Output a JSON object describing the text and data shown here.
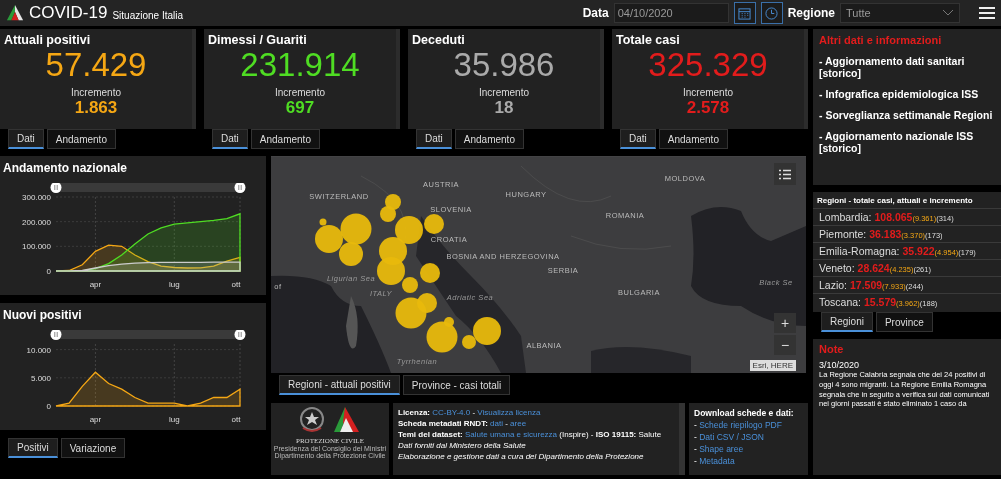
{
  "header": {
    "title": "COVID-19",
    "subtitle": "Situazione Italia",
    "date_label": "Data",
    "date_value": "04/10/2020",
    "region_label": "Regione",
    "region_value": "Tutte"
  },
  "kpis": [
    {
      "title": "Attuali positivi",
      "value": "57.429",
      "inc_label": "Incremento",
      "inc_value": "1.863",
      "color": "#f5a714",
      "tabs": [
        {
          "label": "Dati",
          "selected": true
        },
        {
          "label": "Andamento",
          "selected": false
        }
      ]
    },
    {
      "title": "Dimessi / Guariti",
      "value": "231.914",
      "inc_label": "Incremento",
      "inc_value": "697",
      "color": "#4fdd23",
      "tabs": [
        {
          "label": "Dati",
          "selected": true
        },
        {
          "label": "Andamento",
          "selected": false
        }
      ]
    },
    {
      "title": "Deceduti",
      "value": "35.986",
      "inc_label": "Incremento",
      "inc_value": "18",
      "color": "#aaaaaa",
      "tabs": [
        {
          "label": "Dati",
          "selected": true
        },
        {
          "label": "Andamento",
          "selected": false
        }
      ]
    },
    {
      "title": "Totale casi",
      "value": "325.329",
      "inc_label": "Incremento",
      "inc_value": "2.578",
      "color": "#e21c1c",
      "tabs": [
        {
          "label": "Dati",
          "selected": true
        },
        {
          "label": "Andamento",
          "selected": false
        }
      ]
    }
  ],
  "charts": [
    {
      "title": "Andamento nazionale",
      "chart_data": {
        "type": "area",
        "grid": true,
        "categories": [
          null,
          null,
          null,
          "apr",
          null,
          null,
          null,
          null,
          null,
          "lug",
          null,
          null,
          null,
          null,
          "ott"
        ],
        "ylim": [
          0,
          300
        ],
        "yticks": [
          {
            "value": 0,
            "label": "0"
          },
          {
            "value": 100,
            "label": "100.000"
          },
          {
            "value": 200,
            "label": "200.000"
          },
          {
            "value": 300,
            "label": "300.000"
          }
        ],
        "series": [
          {
            "color": "#f5a714",
            "values": [
              0,
              2,
              25,
              80,
              105,
              100,
              65,
              38,
              20,
              14,
              12,
              13,
              20,
              40,
              55
            ]
          },
          {
            "color": "#4fdd23",
            "values": [
              0,
              0,
              1,
              10,
              30,
              65,
              110,
              150,
              175,
              190,
              195,
              200,
              205,
              212,
              232
            ]
          },
          {
            "color": "#cccccc",
            "values": [
              0,
              0,
              2,
              12,
              22,
              28,
              32,
              34,
              35,
              35,
              35,
              35,
              36,
              36,
              36
            ]
          }
        ]
      }
    },
    {
      "title": "Nuovi positivi",
      "chart_data": {
        "type": "area",
        "grid": true,
        "categories": [
          null,
          null,
          null,
          "apr",
          null,
          null,
          null,
          null,
          null,
          "lug",
          null,
          null,
          null,
          null,
          "ott"
        ],
        "ylim": [
          0,
          11
        ],
        "yticks": [
          {
            "value": 0,
            "label": "0"
          },
          {
            "value": 5,
            "label": "5.000"
          },
          {
            "value": 10,
            "label": "10.000"
          }
        ],
        "series": [
          {
            "color": "#f5a714",
            "values": [
              0,
              0.5,
              3.5,
              6,
              4,
              3,
              1.5,
              0.5,
              0.5,
              0.5,
              0,
              0.5,
              1.5,
              1.5,
              3
            ]
          }
        ]
      }
    }
  ],
  "chart_tabs": [
    {
      "label": "Positivi",
      "selected": true
    },
    {
      "label": "Variazione",
      "selected": false
    }
  ],
  "map": {
    "labels": [
      "SWITZERLAND",
      "AUSTRIA",
      "HUNGARY",
      "MOLDOVA",
      "SLOVENIA",
      "ROMANIA",
      "CROATIA",
      "BOSNIA AND HERZEGOVINA",
      "SERBIA",
      "BULGARIA",
      "ALBANIA",
      "Ligurian Sea",
      "ITALY",
      "Adriatic Sea",
      "Tyrrhenian",
      "Black Se",
      "of"
    ],
    "zoom_in": "+",
    "zoom_out": "−",
    "attribution": "Esri, HERE"
  },
  "map_tabs": [
    {
      "label": "Regioni - attuali positivi",
      "selected": true
    },
    {
      "label": "Province - casi totali",
      "selected": false
    }
  ],
  "logo": {
    "name": "PROTEZIONE CIVILE",
    "line_1": "Presidenza del Consiglio dei Ministri",
    "line_2": "Dipartimento della Protezione Civile"
  },
  "info_lines": [
    [
      {
        "kind": "label",
        "text": "Licenza:"
      },
      {
        "kind": "link",
        "text": "CC-BY-4.0"
      },
      {
        "kind": "text",
        "text": "-"
      },
      {
        "kind": "link",
        "text": "Visualizza licenza"
      }
    ],
    [
      {
        "kind": "label",
        "text": "Scheda metadati RNDT:"
      },
      {
        "kind": "link",
        "text": "dati"
      },
      {
        "kind": "text",
        "text": "-"
      },
      {
        "kind": "link",
        "text": "aree"
      }
    ],
    [
      {
        "kind": "label",
        "text": "Temi del dataset:"
      },
      {
        "kind": "link",
        "text": "Salute umana e sicurezza"
      },
      {
        "kind": "text",
        "text": "(Inspire) -"
      },
      {
        "kind": "label",
        "text": "ISO 19115:"
      },
      {
        "kind": "text",
        "text": "Salute"
      }
    ],
    [
      {
        "kind": "italic",
        "text": "Dati forniti dal Ministero della Salute"
      }
    ],
    [
      {
        "kind": "italic",
        "text": "Elaborazione e gestione dati a cura del Dipartimento della Protezione"
      }
    ]
  ],
  "downloads": {
    "title": "Download schede e dati:",
    "items": [
      {
        "bullet": "-",
        "link": "Schede riepilogo PDF"
      },
      {
        "bullet": "-",
        "link": "Dati CSV / JSON"
      },
      {
        "bullet": "-",
        "link": "Shape aree"
      },
      {
        "bullet": "-",
        "link": "Metadata"
      }
    ]
  },
  "other_info": {
    "title": "Altri dati e informazioni",
    "links": [
      "- Aggiornamento dati sanitari [storico]",
      "- Infografica epidemiologica ISS",
      "- Sorveglianza settimanale Regioni",
      "- Aggiornamento nazionale ISS [storico]"
    ]
  },
  "regions": {
    "title": "Regioni - totale casi, attuali e incremento",
    "rows": [
      {
        "name": "Lombardia:",
        "total": "108.065",
        "current": "(9.361)",
        "increase": "(314)"
      },
      {
        "name": "Piemonte:",
        "total": "36.183",
        "current": "(3.370)",
        "increase": "(173)"
      },
      {
        "name": "Emilia-Romagna:",
        "total": "35.922",
        "current": "(4.954)",
        "increase": "(179)"
      },
      {
        "name": "Veneto:",
        "total": "28.624",
        "current": "(4.235)",
        "increase": "(261)"
      },
      {
        "name": "Lazio:",
        "total": "17.509",
        "current": "(7.933)",
        "increase": "(244)"
      },
      {
        "name": "Toscana:",
        "total": "15.579",
        "current": "(3.962)",
        "increase": "(188)"
      }
    ]
  },
  "region_tabs": [
    {
      "label": "Regioni",
      "selected": true
    },
    {
      "label": "Province",
      "selected": false
    }
  ],
  "note": {
    "title": "Note",
    "date": "3/10/2020",
    "text": "La Regione Calabria segnala che dei 24 positivi di oggi 4 sono migranti. La Regione Emilia Romagna segnala che in seguito a verifica sui dati comunicati nei giorni passati è stato eliminato 1 caso da"
  }
}
